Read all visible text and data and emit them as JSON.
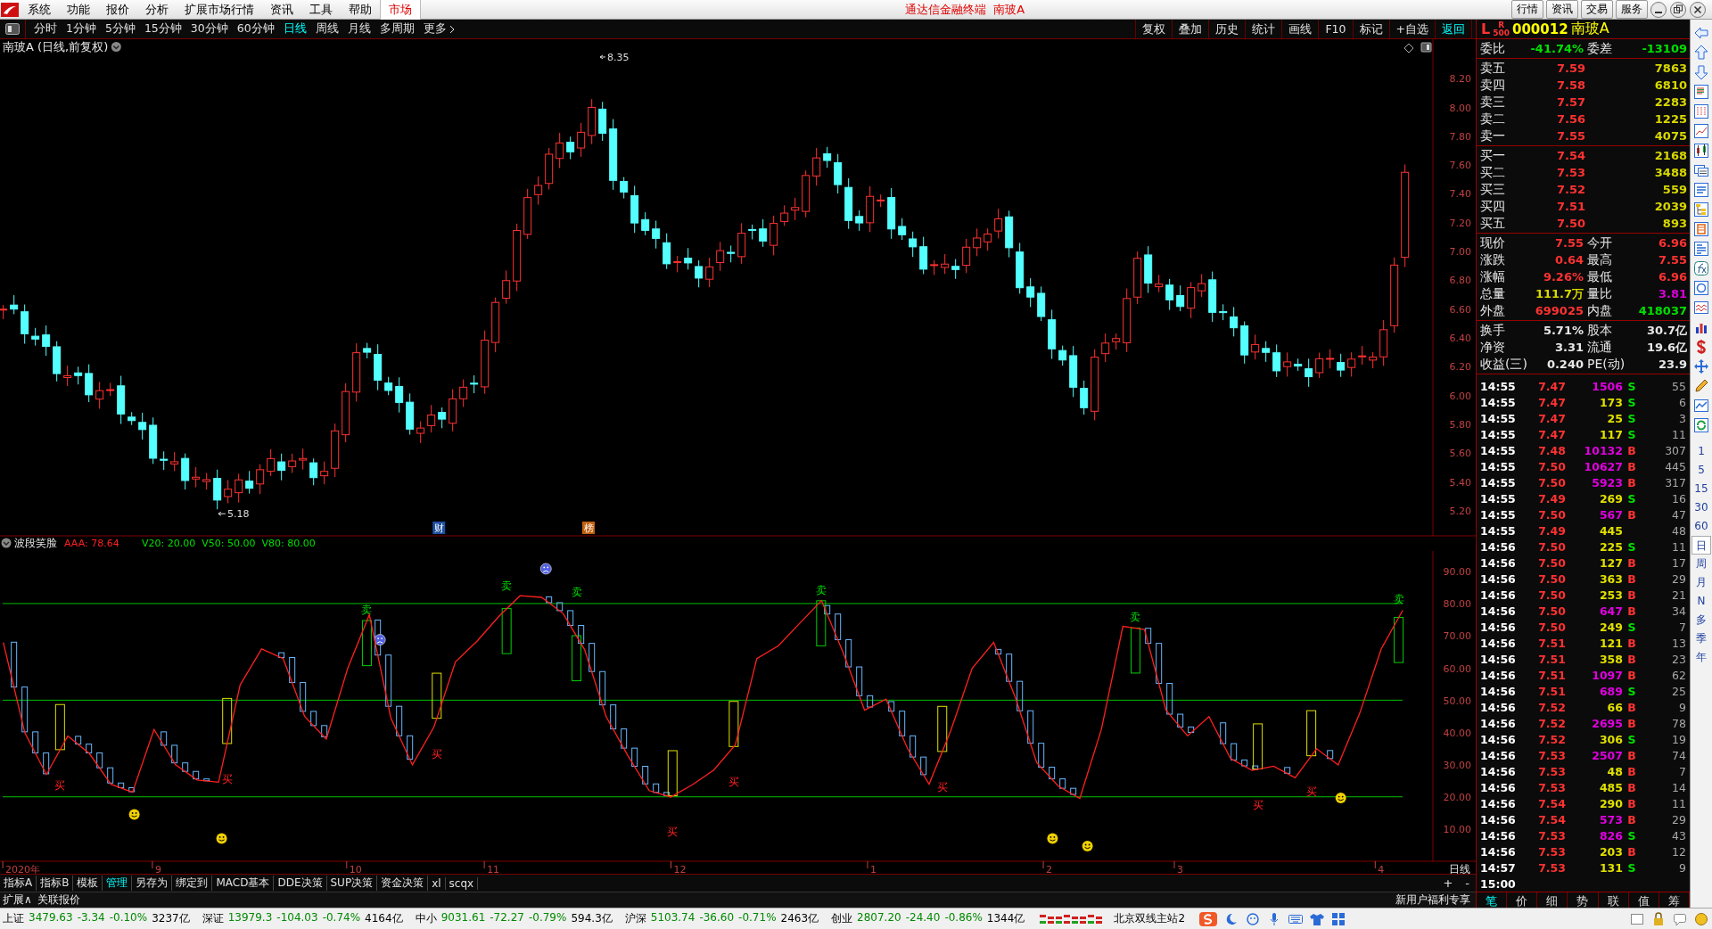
{
  "title_bar": {
    "menu": [
      {
        "label": "系统",
        "active": false
      },
      {
        "label": "功能",
        "active": false
      },
      {
        "label": "报价",
        "active": false
      },
      {
        "label": "分析",
        "active": false
      },
      {
        "label": "扩展市场行情",
        "active": false
      },
      {
        "label": "资讯",
        "active": false
      },
      {
        "label": "工具",
        "active": false
      },
      {
        "label": "帮助",
        "active": false
      },
      {
        "label": "市场",
        "active": true
      }
    ],
    "title": "通达信金融终端  南玻A",
    "buttons": [
      "行情",
      "资讯",
      "交易",
      "服务"
    ]
  },
  "toolbar": {
    "periods": [
      {
        "label": "分时",
        "selected": false
      },
      {
        "label": "1分钟",
        "selected": false
      },
      {
        "label": "5分钟",
        "selected": false
      },
      {
        "label": "15分钟",
        "selected": false
      },
      {
        "label": "30分钟",
        "selected": false
      },
      {
        "label": "60分钟",
        "selected": false
      },
      {
        "label": "日线",
        "selected": true
      },
      {
        "label": "周线",
        "selected": false
      },
      {
        "label": "月线",
        "selected": false
      },
      {
        "label": "多周期",
        "selected": false
      },
      {
        "label": "更多",
        "selected": false
      }
    ],
    "actions": [
      {
        "label": "复权",
        "highlighted": false
      },
      {
        "label": "叠加",
        "highlighted": false
      },
      {
        "label": "历史",
        "highlighted": false
      },
      {
        "label": "统计",
        "highlighted": false
      },
      {
        "label": "画线",
        "highlighted": false
      },
      {
        "label": "F10",
        "highlighted": false
      },
      {
        "label": "标记",
        "highlighted": false
      },
      {
        "label": "+自选",
        "highlighted": false
      },
      {
        "label": "返回",
        "highlighted": true
      }
    ]
  },
  "chart": {
    "stock_title": "南玻A (日线,前复权)",
    "price_axis": [
      "8.20",
      "8.00",
      "7.80",
      "7.60",
      "7.40",
      "7.20",
      "7.00",
      "6.80",
      "6.60",
      "6.40",
      "6.20",
      "6.00",
      "5.80",
      "5.60",
      "5.40",
      "5.20"
    ],
    "high_label": "8.35",
    "low_label": "5.18",
    "event_marks": [
      {
        "label": "财",
        "kind": "finance"
      },
      {
        "label": "榜",
        "kind": "list"
      }
    ],
    "indicator": {
      "name": "波段笑脸",
      "readings": [
        {
          "text": "AAA: 78.64",
          "kind": "main"
        },
        {
          "text": "V20: 20.00",
          "kind": "level"
        },
        {
          "text": "V50: 50.00",
          "kind": "level"
        },
        {
          "text": "V80: 80.00",
          "kind": "level"
        }
      ],
      "chart_data": {
        "type": "line",
        "ylim": [
          0,
          96.4
        ],
        "yticks": [
          {
            "value": 90,
            "label": "90.00"
          },
          {
            "value": 80,
            "label": "80.00"
          },
          {
            "value": 70,
            "label": "70.00"
          },
          {
            "value": 60,
            "label": "60.00"
          },
          {
            "value": 50,
            "label": "50.00"
          },
          {
            "value": 40,
            "label": "40.00"
          },
          {
            "value": 30,
            "label": "30.00"
          },
          {
            "value": 20,
            "label": "20.00"
          },
          {
            "value": 10,
            "label": "10.00"
          }
        ],
        "series": [
          {
            "color": "#ff2020",
            "values": [
              68,
              40,
              27,
              39,
              33.5,
              24,
              21.5,
              41,
              30,
              25.3,
              24.6,
              54.8,
              66,
              63,
              45,
              38,
              60,
              76.6,
              44.6,
              30,
              41.7,
              62,
              68.4,
              76,
              82.5,
              82,
              77,
              65.8,
              45,
              33,
              22,
              20,
              23.8,
              28.4,
              36.2,
              63,
              67,
              74,
              81,
              65,
              47,
              50.4,
              35,
              24,
              40.5,
              60,
              68,
              51,
              30.7,
              23.4,
              19.6,
              41,
              73,
              72,
              47,
              39,
              45,
              32,
              28.3,
              29.6,
              26,
              35,
              30,
              46,
              66,
              78
            ]
          }
        ]
      },
      "signals": [
        {
          "kind": "buy",
          "label": "买"
        },
        {
          "kind": "buy",
          "label": "买"
        },
        {
          "kind": "sell",
          "label": "卖"
        },
        {
          "kind": "buy",
          "label": "买"
        },
        {
          "kind": "sell",
          "label": "卖"
        },
        {
          "kind": "sell",
          "label": "卖"
        },
        {
          "kind": "buy",
          "label": "买"
        },
        {
          "kind": "buy",
          "label": "买"
        },
        {
          "kind": "sell",
          "label": "卖"
        },
        {
          "kind": "buy",
          "label": "买"
        },
        {
          "kind": "sell",
          "label": "卖"
        },
        {
          "kind": "buy",
          "label": "买"
        },
        {
          "kind": "buy",
          "label": "买"
        },
        {
          "kind": "sell",
          "label": "卖"
        }
      ]
    },
    "date_axis": [
      "2020年",
      "9",
      "10",
      "11",
      "12",
      "1",
      "2",
      "3",
      "4"
    ],
    "period_label": "日线"
  },
  "indicator_tabs": [
    {
      "label": "指标A",
      "selected": false
    },
    {
      "label": "指标B",
      "selected": false
    },
    {
      "label": "模板",
      "selected": false
    },
    {
      "label": "管理",
      "selected": true
    },
    {
      "label": "另存为",
      "selected": false
    },
    {
      "label": "绑定到",
      "selected": false
    },
    {
      "label": "MACD基本",
      "selected": false
    },
    {
      "label": "DDE决策",
      "selected": false
    },
    {
      "label": "SUP决策",
      "selected": false
    },
    {
      "label": "资金决策",
      "selected": false
    },
    {
      "label": "xl",
      "selected": false
    },
    {
      "label": "scqx",
      "selected": false
    }
  ],
  "zoom_buttons": [
    "+",
    "-"
  ],
  "extension_row": {
    "items": [
      "扩展∧",
      "关联报价"
    ],
    "promo": "新用户福利专享"
  },
  "quote": {
    "header": {
      "market": "L",
      "tag": "R",
      "tag_sub": "500",
      "code": "000012",
      "name": "南玻A"
    },
    "order_ratio": [
      {
        "label": "委比",
        "value": "-41.74%",
        "color": "#00e000"
      },
      {
        "label": "委差",
        "value": "-13109",
        "color": "#00e000"
      }
    ],
    "asks": [
      {
        "label": "卖五",
        "price": "7.59",
        "volume": "7863"
      },
      {
        "label": "卖四",
        "price": "7.58",
        "volume": "6810"
      },
      {
        "label": "卖三",
        "price": "7.57",
        "volume": "2283"
      },
      {
        "label": "卖二",
        "price": "7.56",
        "volume": "1225"
      },
      {
        "label": "卖一",
        "price": "7.55",
        "volume": "4075"
      }
    ],
    "bids": [
      {
        "label": "买一",
        "price": "7.54",
        "volume": "2168"
      },
      {
        "label": "买二",
        "price": "7.53",
        "volume": "3488"
      },
      {
        "label": "买三",
        "price": "7.52",
        "volume": "559"
      },
      {
        "label": "买四",
        "price": "7.51",
        "volume": "2039"
      },
      {
        "label": "买五",
        "price": "7.50",
        "volume": "893"
      }
    ],
    "stats": [
      {
        "label": "现价",
        "value": "7.55",
        "color": "#ff3232"
      },
      {
        "label": "今开",
        "value": "6.96",
        "color": "#ff3232"
      },
      {
        "label": "涨跌",
        "value": "0.64",
        "color": "#ff3232"
      },
      {
        "label": "最高",
        "value": "7.55",
        "color": "#ff3232"
      },
      {
        "label": "涨幅",
        "value": "9.26%",
        "color": "#ff3232"
      },
      {
        "label": "最低",
        "value": "6.96",
        "color": "#ff3232"
      },
      {
        "label": "总量",
        "value": "111.7万",
        "color": "#d8d800"
      },
      {
        "label": "量比",
        "value": "3.81",
        "color": "#d800d8"
      },
      {
        "label": "外盘",
        "value": "699025",
        "color": "#ff3232"
      },
      {
        "label": "内盘",
        "value": "418037",
        "color": "#00e000"
      }
    ],
    "fundamentals": [
      {
        "label": "换手",
        "value": "5.71%"
      },
      {
        "label": "股本",
        "value": "30.7亿"
      },
      {
        "label": "净资",
        "value": "3.31"
      },
      {
        "label": "流通",
        "value": "19.6亿"
      },
      {
        "label": "收益(三)",
        "value": "0.240"
      },
      {
        "label": "PE(动)",
        "value": "23.9"
      }
    ],
    "ticks": [
      {
        "time": "14:55",
        "price": "7.47",
        "volume": "1506",
        "large": true,
        "kind": "sell",
        "side": "S",
        "count": "55"
      },
      {
        "time": "14:55",
        "price": "7.47",
        "volume": "173",
        "large": false,
        "kind": "sell",
        "side": "S",
        "count": "6"
      },
      {
        "time": "14:55",
        "price": "7.47",
        "volume": "25",
        "large": false,
        "kind": "sell",
        "side": "S",
        "count": "3"
      },
      {
        "time": "14:55",
        "price": "7.47",
        "volume": "117",
        "large": false,
        "kind": "sell",
        "side": "S",
        "count": "11"
      },
      {
        "time": "14:55",
        "price": "7.48",
        "volume": "10132",
        "large": true,
        "kind": "buy",
        "side": "B",
        "count": "307"
      },
      {
        "time": "14:55",
        "price": "7.50",
        "volume": "10627",
        "large": true,
        "kind": "buy",
        "side": "B",
        "count": "445"
      },
      {
        "time": "14:55",
        "price": "7.50",
        "volume": "5923",
        "large": true,
        "kind": "buy",
        "side": "B",
        "count": "317"
      },
      {
        "time": "14:55",
        "price": "7.49",
        "volume": "269",
        "large": false,
        "kind": "sell",
        "side": "S",
        "count": "16"
      },
      {
        "time": "14:55",
        "price": "7.50",
        "volume": "567",
        "large": true,
        "kind": "buy",
        "side": "B",
        "count": "47"
      },
      {
        "time": "14:55",
        "price": "7.49",
        "volume": "445",
        "large": false,
        "kind": "none",
        "count": "48"
      },
      {
        "time": "14:56",
        "price": "7.50",
        "volume": "225",
        "large": false,
        "kind": "sell",
        "side": "S",
        "count": "11"
      },
      {
        "time": "14:56",
        "price": "7.50",
        "volume": "127",
        "large": false,
        "kind": "buy",
        "side": "B",
        "count": "17"
      },
      {
        "time": "14:56",
        "price": "7.50",
        "volume": "363",
        "large": false,
        "kind": "buy",
        "side": "B",
        "count": "29"
      },
      {
        "time": "14:56",
        "price": "7.50",
        "volume": "253",
        "large": false,
        "kind": "buy",
        "side": "B",
        "count": "21"
      },
      {
        "time": "14:56",
        "price": "7.50",
        "volume": "647",
        "large": true,
        "kind": "buy",
        "side": "B",
        "count": "34"
      },
      {
        "time": "14:56",
        "price": "7.50",
        "volume": "249",
        "large": false,
        "kind": "sell",
        "side": "S",
        "count": "7"
      },
      {
        "time": "14:56",
        "price": "7.51",
        "volume": "121",
        "large": false,
        "kind": "buy",
        "side": "B",
        "count": "13"
      },
      {
        "time": "14:56",
        "price": "7.51",
        "volume": "358",
        "large": false,
        "kind": "buy",
        "side": "B",
        "count": "23"
      },
      {
        "time": "14:56",
        "price": "7.51",
        "volume": "1097",
        "large": true,
        "kind": "buy",
        "side": "B",
        "count": "62"
      },
      {
        "time": "14:56",
        "price": "7.51",
        "volume": "689",
        "large": true,
        "kind": "sell",
        "side": "S",
        "count": "25"
      },
      {
        "time": "14:56",
        "price": "7.52",
        "volume": "66",
        "large": false,
        "kind": "buy",
        "side": "B",
        "count": "9"
      },
      {
        "time": "14:56",
        "price": "7.52",
        "volume": "2695",
        "large": true,
        "kind": "buy",
        "side": "B",
        "count": "78"
      },
      {
        "time": "14:56",
        "price": "7.52",
        "volume": "306",
        "large": false,
        "kind": "sell",
        "side": "S",
        "count": "19"
      },
      {
        "time": "14:56",
        "price": "7.53",
        "volume": "2507",
        "large": true,
        "kind": "buy",
        "side": "B",
        "count": "74"
      },
      {
        "time": "14:56",
        "price": "7.53",
        "volume": "48",
        "large": false,
        "kind": "buy",
        "side": "B",
        "count": "7"
      },
      {
        "time": "14:56",
        "price": "7.53",
        "volume": "485",
        "large": false,
        "kind": "buy",
        "side": "B",
        "count": "14"
      },
      {
        "time": "14:56",
        "price": "7.54",
        "volume": "290",
        "large": false,
        "kind": "buy",
        "side": "B",
        "count": "11"
      },
      {
        "time": "14:56",
        "price": "7.54",
        "volume": "573",
        "large": true,
        "kind": "buy",
        "side": "B",
        "count": "29"
      },
      {
        "time": "14:56",
        "price": "7.53",
        "volume": "826",
        "large": true,
        "kind": "sell",
        "side": "S",
        "count": "43"
      },
      {
        "time": "14:56",
        "price": "7.53",
        "volume": "203",
        "large": false,
        "kind": "buy",
        "side": "B",
        "count": "12"
      },
      {
        "time": "14:57",
        "price": "7.53",
        "volume": "131",
        "large": false,
        "kind": "sell",
        "side": "S",
        "count": "9"
      },
      {
        "time": "15:00"
      }
    ],
    "tabs": [
      {
        "label": "笔",
        "selected": true
      },
      {
        "label": "价",
        "selected": false
      },
      {
        "label": "细",
        "selected": false
      },
      {
        "label": "势",
        "selected": false
      },
      {
        "label": "联",
        "selected": false
      },
      {
        "label": "值",
        "selected": false
      },
      {
        "label": "筹",
        "selected": false
      }
    ]
  },
  "sidebar": {
    "periods": [
      {
        "label": "1",
        "selected": false
      },
      {
        "label": "5",
        "selected": false
      },
      {
        "label": "15",
        "selected": false
      },
      {
        "label": "30",
        "selected": false
      },
      {
        "label": "60",
        "selected": false
      },
      {
        "label": "日",
        "selected": true
      },
      {
        "label": "周",
        "selected": false
      },
      {
        "label": "月",
        "selected": false
      },
      {
        "label": "N",
        "selected": false
      },
      {
        "label": "多",
        "selected": false
      },
      {
        "label": "季",
        "selected": false
      },
      {
        "label": "年",
        "selected": false
      }
    ]
  },
  "status_bar": {
    "indices": [
      {
        "name": "上证",
        "value": "3479.63",
        "change": "-3.34",
        "percent": "-0.10%",
        "amount": "3237亿"
      },
      {
        "name": "深证",
        "value": "13979.3",
        "change": "-104.03",
        "percent": "-0.74%",
        "amount": "4164亿"
      },
      {
        "name": "中小",
        "value": "9031.61",
        "change": "-72.27",
        "percent": "-0.79%",
        "amount": "594.3亿"
      },
      {
        "name": "沪深",
        "value": "5103.74",
        "change": "-36.60",
        "percent": "-0.71%",
        "amount": "2463亿"
      },
      {
        "name": "创业",
        "value": "2807.20",
        "change": "-24.40",
        "percent": "-0.86%",
        "amount": "1344亿"
      }
    ],
    "server": "北京双线主站2"
  }
}
